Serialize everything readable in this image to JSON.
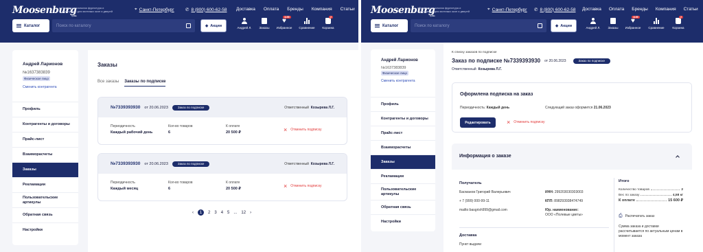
{
  "header": {
    "logo": "Moosenburg",
    "logo_sub": "by Miles",
    "tagline": "Профессиональная фурнитура и инструмент для монтажа окон и дверей",
    "city": "Санкт-Петербург",
    "phone": "8 (800) 600-62-58",
    "nav": [
      "Доставка",
      "Оплата",
      "Бренды",
      "Компания",
      "Статьи"
    ],
    "catalog_label": "Каталог",
    "search_placeholder": "Поиск по каталогу",
    "promo_label": "Акции",
    "user_icons": [
      {
        "label": "Андрей Л.",
        "icon": "person-icon"
      },
      {
        "label": "Заказы",
        "icon": "document-icon"
      },
      {
        "label": "Избранное",
        "icon": "heart-icon",
        "badge": "1155"
      },
      {
        "label": "Сравнение",
        "icon": "compare-icon"
      },
      {
        "label": "Корзина",
        "icon": "cart-icon",
        "badge": "2"
      }
    ]
  },
  "user": {
    "name": "Андрей Ларионов",
    "id": "№1637383839",
    "type": "Физическое лицо",
    "change_label": "Сменить контрагента"
  },
  "menu_left": [
    "Профиль",
    "Контрагенты и договоры",
    "Прайс-лист",
    "Взаиморасчеты",
    "Заказы",
    "Рекламации",
    "Пользовательские артикулы",
    "Обратная связь",
    "Настройки"
  ],
  "menu_right": [
    "Профиль",
    "Контрагенты и договоры",
    "Прайс-лист",
    "Взаиморасчеты",
    "Заказы",
    "Рекламации",
    "Пользовательские артикулы",
    "Обратная связь",
    "Настройки"
  ],
  "orders": {
    "title": "Заказы",
    "tabs": [
      "Все заказы",
      "Заказы по подписке"
    ],
    "items": [
      {
        "number": "№7339393930",
        "date": "от 20.06.2023",
        "status": "Заказ по подписке",
        "responsible_label": "Ответственный",
        "responsible": "Козырева Л.Г.",
        "period_label": "Периодичность",
        "period": "Каждый рабочий день",
        "qty_label": "Кол-во товаров",
        "qty": "6",
        "pay_label": "К оплате",
        "pay": "20 500 ₽",
        "cancel_label": "Отменить подписку"
      },
      {
        "number": "№7339393930",
        "date": "от 20.06.2023",
        "status": "Заказ по подписке",
        "responsible_label": "Ответственный",
        "responsible": "Козырева Л.Г.",
        "period_label": "Периодичность",
        "period": "Каждый месяц",
        "qty_label": "Кол-во товаров",
        "qty": "6",
        "pay_label": "К оплате",
        "pay": "20 500 ₽",
        "cancel_label": "Отменить подписку"
      }
    ],
    "pagination": {
      "pages": [
        "1",
        "2",
        "3",
        "4",
        "5",
        "...",
        "12"
      ],
      "current": "1"
    }
  },
  "detail": {
    "back_label": "К списку заказов по подписке",
    "title": "Заказ по подписке №7339393930",
    "date": "от 20.06.2023",
    "status": "Заказ по подписке",
    "responsible_label": "Ответственный",
    "responsible": "Козырева Л.Г.",
    "subscription": {
      "title": "Оформлена подписка на заказ",
      "period_label": "Периодичность:",
      "period": "Каждый день",
      "next_label": "Следующий заказ оформится",
      "next_date": "21.06.2023",
      "edit_label": "Редактировать",
      "cancel_label": "Отменить подписку"
    },
    "info": {
      "title": "Информация о заказе",
      "recipient_label": "Получатель",
      "recipient_name": "Басманов Григорий Валерьевич",
      "phone": "+ 7 (999) 000-99-11",
      "email": "mailto:basgrish999@gmail.com",
      "inn_label": "ИНН:",
      "inn": "299203030303003",
      "kpp_label": "КПП:",
      "kpp": "898293938474749",
      "legal_label": "Юр. наименование:",
      "legal": "ООО «Полевые цветы»",
      "delivery_label": "Доставка",
      "delivery": "Пункт выдачи",
      "total_label": "Итого",
      "items_label": "Количество товаров",
      "items": "2",
      "weight_label": "Вес по заказу",
      "weight": "4,58 кг",
      "topay_label": "К оплате",
      "topay": "15 600 ₽",
      "print_label": "Распечатать заказ",
      "note": "Сумма заказа и доставки рассчитывается по актуальным ценам в момент заказа"
    }
  }
}
